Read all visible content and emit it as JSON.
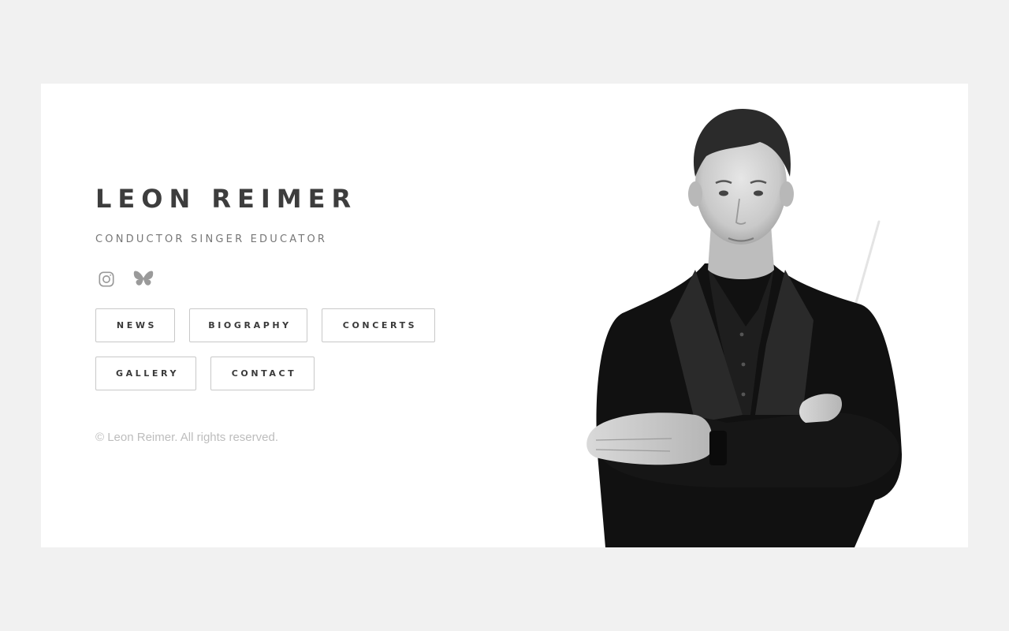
{
  "artist": {
    "name": "LEON REIMER",
    "tagline": "CONDUCTOR SINGER EDUCATOR"
  },
  "socials": [
    {
      "icon": "instagram-icon"
    },
    {
      "icon": "bluesky-butterfly-icon"
    }
  ],
  "nav": {
    "news": "NEWS",
    "biography": "BIOGRAPHY",
    "concerts": "CONCERTS",
    "gallery": "GALLERY",
    "contact": "CONTACT"
  },
  "footer": {
    "copyright": "© Leon Reimer. All rights reserved."
  },
  "colors": {
    "page_background": "#f1f1f1",
    "card_background": "#ffffff",
    "heading": "#3d3d3d",
    "subtitle": "#777777",
    "button_border": "#c8c8c8",
    "copyright": "#bdbdbd",
    "icon": "#9a9a9a"
  }
}
